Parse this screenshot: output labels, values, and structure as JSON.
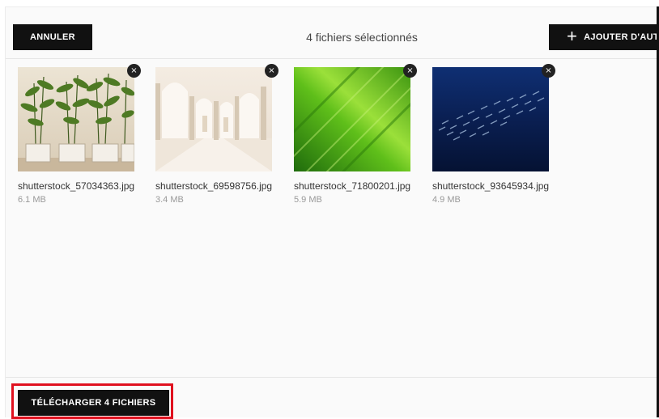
{
  "header": {
    "cancel_label": "ANNULER",
    "title": "4 fichiers sélectionnés",
    "add_label": "AJOUTER D'AUT"
  },
  "files": [
    {
      "name": "shutterstock_57034363.jpg",
      "size": "6.1 MB",
      "thumbnail": "potted-bamboo-plants"
    },
    {
      "name": "shutterstock_69598756.jpg",
      "size": "3.4 MB",
      "thumbnail": "white-arched-hallway"
    },
    {
      "name": "shutterstock_71800201.jpg",
      "size": "5.9 MB",
      "thumbnail": "green-diagonal-streaks"
    },
    {
      "name": "shutterstock_93645934.jpg",
      "size": "4.9 MB",
      "thumbnail": "fish-school-underwater"
    }
  ],
  "footer": {
    "upload_label": "TÉLÉCHARGER 4 FICHIERS"
  },
  "icons": {
    "remove": "×",
    "plus": "+"
  },
  "colors": {
    "button_bg": "#111111",
    "highlight": "#e0101e"
  }
}
